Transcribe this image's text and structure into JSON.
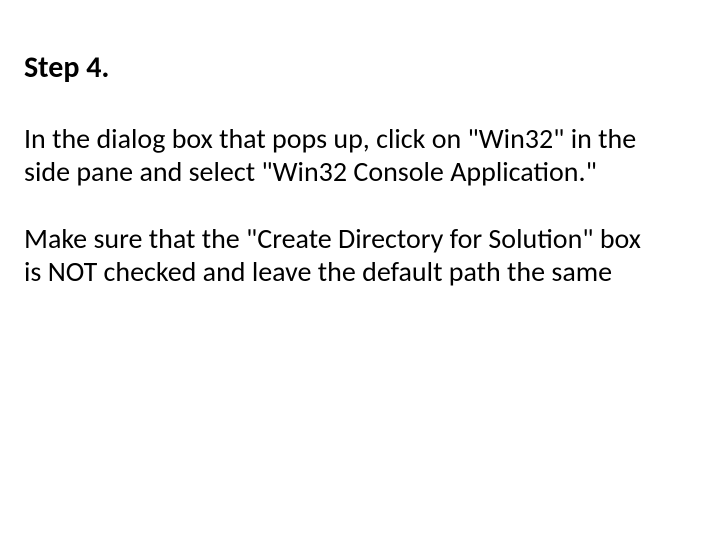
{
  "heading": "Step 4.",
  "paragraph1": "In the dialog box that pops up, click on \"Win32\" in the side pane and select \"Win32 Console Application.\"",
  "paragraph2": "Make sure that the \"Create Directory for Solution\" box is NOT checked and leave the default path the same"
}
